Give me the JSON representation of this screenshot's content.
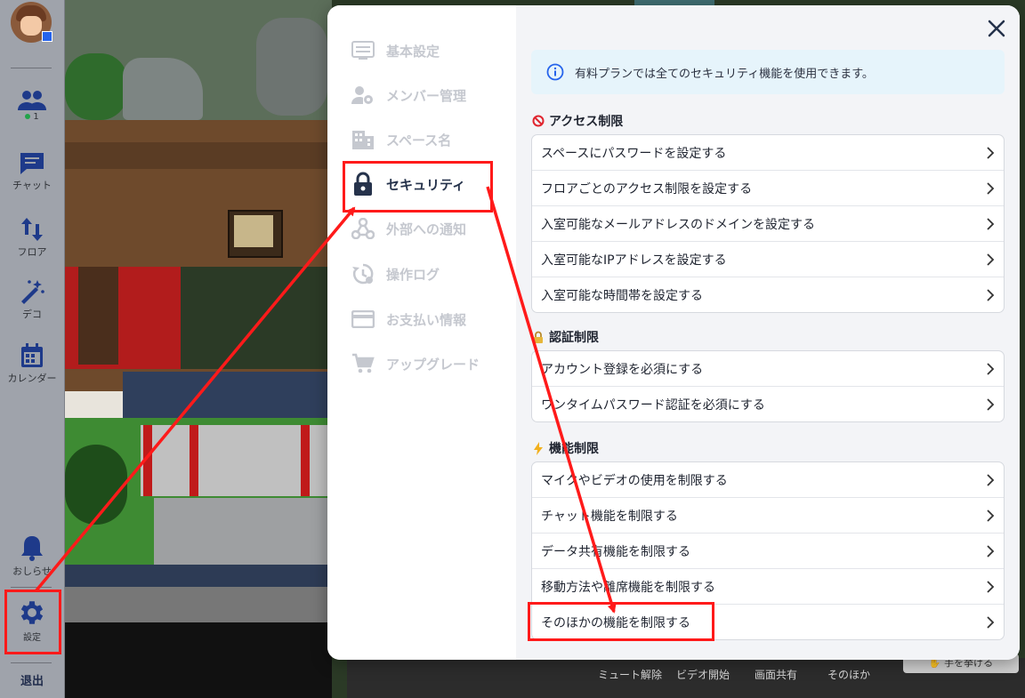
{
  "sidebar": {
    "online_count": "1",
    "items": [
      {
        "label": ""
      },
      {
        "label": "チャット"
      },
      {
        "label": "フロア"
      },
      {
        "label": "デコ"
      },
      {
        "label": "カレンダー"
      },
      {
        "label": "おしらせ"
      },
      {
        "label": "設定"
      }
    ],
    "exit_label": "退出"
  },
  "modal": {
    "menu": [
      {
        "label": "基本設定",
        "icon": "tune-icon"
      },
      {
        "label": "メンバー管理",
        "icon": "member-gear-icon"
      },
      {
        "label": "スペース名",
        "icon": "building-icon"
      },
      {
        "label": "セキュリティ",
        "icon": "lock-icon",
        "active": true
      },
      {
        "label": "外部への通知",
        "icon": "webhook-icon"
      },
      {
        "label": "操作ログ",
        "icon": "history-gear-icon"
      },
      {
        "label": "お支払い情報",
        "icon": "credit-card-icon"
      },
      {
        "label": "アップグレード",
        "icon": "cart-icon"
      }
    ],
    "info_text": "有料プランでは全てのセキュリティ機能を使用できます。",
    "sections": [
      {
        "title": "アクセス制限",
        "icon": "prohibited-icon",
        "items": [
          "スペースにパスワードを設定する",
          "フロアごとのアクセス制限を設定する",
          "入室可能なメールアドレスのドメインを設定する",
          "入室可能なIPアドレスを設定する",
          "入室可能な時間帯を設定する"
        ]
      },
      {
        "title": "認証制限",
        "icon": "lock-key-icon",
        "items": [
          "アカウント登録を必須にする",
          "ワンタイムパスワード認証を必須にする"
        ]
      },
      {
        "title": "機能制限",
        "icon": "lightning-icon",
        "items": [
          "マイクやビデオの使用を制限する",
          "チャット機能を制限する",
          "データ共有機能を制限する",
          "移動方法や離席機能を制限する",
          "そのほかの機能を制限する"
        ]
      }
    ]
  },
  "bottom_bar": {
    "labels": [
      "ミュート解除",
      "ビデオ開始",
      "画面共有",
      "そのほか"
    ],
    "raise_hand": "手を挙げる"
  },
  "colors": {
    "annotation": "#ff1a1a",
    "active_text": "#25324b",
    "inactive_text": "#c5c8cf",
    "info_bg": "#e6f4fb"
  }
}
